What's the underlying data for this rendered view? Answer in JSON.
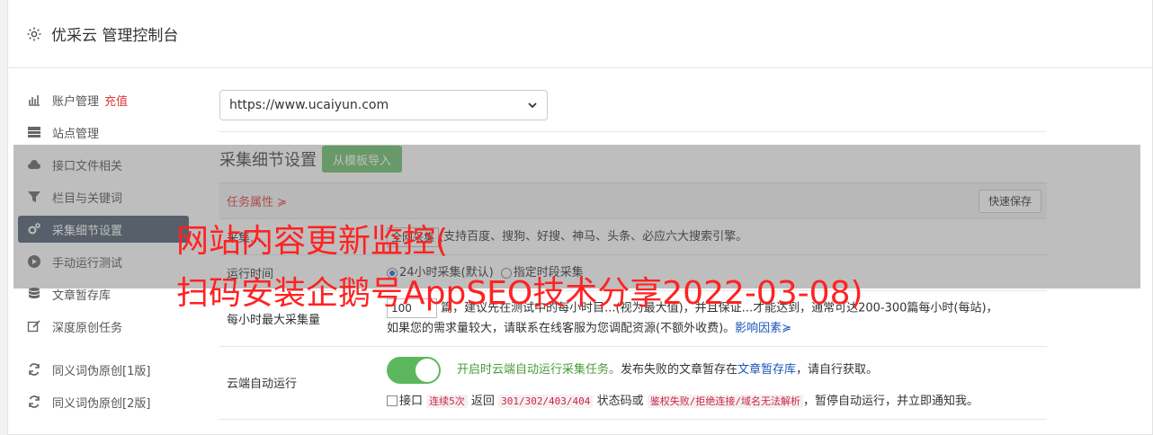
{
  "header": {
    "title": "优采云 管理控制台"
  },
  "sidebar": {
    "items": [
      {
        "label": "账户管理",
        "extra": "充值"
      },
      {
        "label": "站点管理"
      },
      {
        "label": "接口文件相关"
      },
      {
        "label": "栏目与关键词"
      },
      {
        "label": "采集细节设置"
      },
      {
        "label": "手动运行测试"
      },
      {
        "label": "文章暂存库"
      },
      {
        "label": "深度原创任务"
      },
      {
        "label": "同义词伪原创[1版]"
      },
      {
        "label": "同义词伪原创[2版]"
      }
    ]
  },
  "site_select": {
    "value": "https://www.ucaiyun.com"
  },
  "section": {
    "title": "采集细节设置",
    "import_btn": "从模板导入",
    "task_attr": "任务属性 ≽",
    "quick_save": "快速保存",
    "source_row": {
      "label": "采集...",
      "opt": "全网采集",
      "desc": "(支持百度、搜狗、好搜、神马、头条、必应六大搜索引擎。"
    },
    "run_time": {
      "label": "运行时间",
      "opt1": "24小时采集(默认)",
      "opt2": "指定时段采集"
    },
    "max_per_hour": {
      "label": "每小时最大采集量",
      "value": "100",
      "line1": "篇，建议先在测试中的每小时目...(视为最大值)，并且保证...才能达到，通常可达200-300篇每小时(每站)，",
      "line2": "如果您的需求量较大，请联系在线客服为您调配资源(不额外收费)。",
      "link": "影响因素≽"
    },
    "cloud_run": {
      "label": "云端自动运行",
      "on_text": "开启时云端自动运行采集任务。",
      "desc_pre": "发布失败的文章暂存在",
      "desc_link": "文章暂存库",
      "desc_post": "，请自行获取。",
      "cb_label": "接口",
      "code1": "连续5次",
      "mid1": "返回",
      "code2": "301/302/403/404",
      "mid2": "状态码或",
      "code3": "鉴权失败/拒绝连接/域名无法解析",
      "tail": "，暂停自动运行，并立即通知我。"
    }
  },
  "watermark": {
    "line1": "网站内容更新监控(",
    "line2": "扫码安装企鹅号AppSEO技术分享2022-03-08)"
  }
}
